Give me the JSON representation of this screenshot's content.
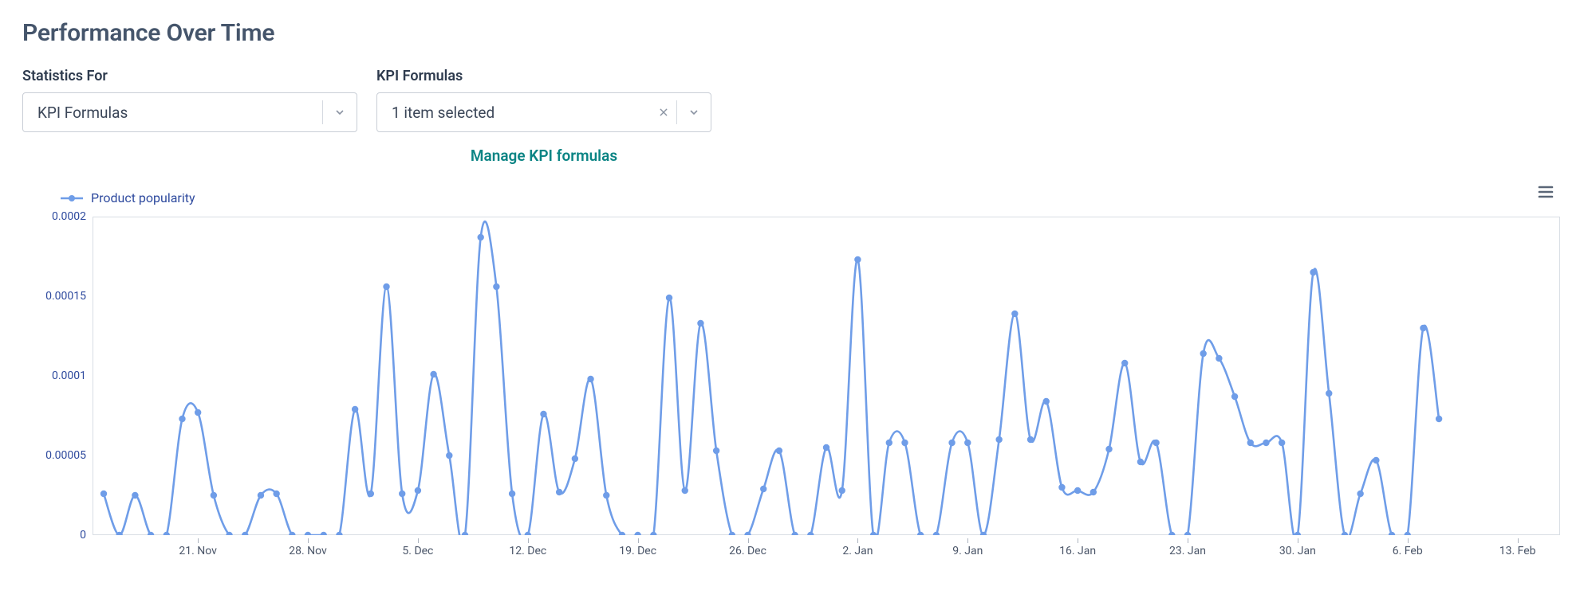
{
  "header": {
    "title": "Performance Over Time"
  },
  "controls": {
    "statistics_for": {
      "label": "Statistics For",
      "value": "KPI Formulas"
    },
    "kpi_formulas": {
      "label": "KPI Formulas",
      "value": "1 item selected",
      "manage_link": "Manage KPI formulas"
    }
  },
  "chart_data": {
    "type": "line",
    "series": [
      {
        "name": "Product popularity",
        "values": [
          2.6e-05,
          0.0,
          2.5e-05,
          0.0,
          0.0,
          7.3e-05,
          7.7e-05,
          2.5e-05,
          0.0,
          0.0,
          2.5e-05,
          2.6e-05,
          0.0,
          0.0,
          0.0,
          0.0,
          7.9e-05,
          2.6e-05,
          0.000156,
          2.6e-05,
          2.8e-05,
          0.000101,
          5e-05,
          0.0,
          0.000187,
          0.000156,
          2.6e-05,
          0.0,
          7.6e-05,
          2.7e-05,
          4.8e-05,
          9.8e-05,
          2.5e-05,
          0.0,
          0.0,
          0.0,
          0.000149,
          2.8e-05,
          0.000133,
          5.3e-05,
          0.0,
          0.0,
          2.9e-05,
          5.3e-05,
          0.0,
          0.0,
          5.5e-05,
          2.8e-05,
          0.000173,
          0.0,
          5.8e-05,
          5.8e-05,
          0.0,
          0.0,
          5.8e-05,
          5.8e-05,
          0.0,
          6e-05,
          0.000139,
          6e-05,
          8.4e-05,
          3e-05,
          2.8e-05,
          2.7e-05,
          5.4e-05,
          0.000108,
          4.6e-05,
          5.8e-05,
          0.0,
          0.0,
          0.000114,
          0.000111,
          8.7e-05,
          5.8e-05,
          5.8e-05,
          5.8e-05,
          0.0,
          0.000165,
          8.9e-05,
          0.0,
          2.6e-05,
          4.7e-05,
          0.0,
          0.0,
          0.00013,
          7.3e-05
        ]
      }
    ],
    "ylabel": "",
    "xlabel": "",
    "ylim": [
      0,
      0.0002
    ],
    "y_ticks": [
      0,
      5e-05,
      0.0001,
      0.00015,
      0.0002
    ],
    "x_tick_labels": [
      "21. Nov",
      "28. Nov",
      "5. Dec",
      "12. Dec",
      "19. Dec",
      "26. Dec",
      "2. Jan",
      "9. Jan",
      "16. Jan",
      "23. Jan",
      "30. Jan",
      "6. Feb",
      "13. Feb"
    ],
    "x_tick_positions": [
      6,
      13,
      20,
      27,
      34,
      41,
      48,
      55,
      62,
      69,
      76,
      83,
      90
    ],
    "x_start_index": 0,
    "x_count": 93,
    "colors": {
      "series": "#6f9de8",
      "marker": "#6f9de8"
    }
  }
}
